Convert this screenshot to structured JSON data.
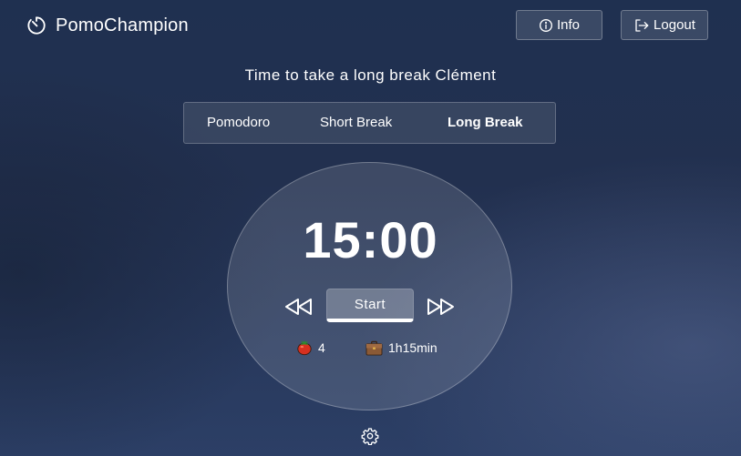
{
  "app": {
    "name": "PomoChampion",
    "logo_icon": "timer-icon"
  },
  "header": {
    "info_label": "Info",
    "info_icon": "info-icon",
    "logout_label": "Logout",
    "logout_icon": "logout-icon"
  },
  "greeting": "Time to take a long break Clément",
  "tabs": [
    {
      "label": "Pomodoro",
      "active": false
    },
    {
      "label": "Short Break",
      "active": false
    },
    {
      "label": "Long Break",
      "active": true
    }
  ],
  "timer": {
    "time": "15:00",
    "start_label": "Start",
    "prev_icon": "skip-back-icon",
    "next_icon": "skip-forward-icon"
  },
  "stats": {
    "pomodoros": "4",
    "pomodoro_icon": "tomato-icon",
    "work_time": "1h15min",
    "work_icon": "briefcase-icon"
  },
  "settings_icon": "gear-icon",
  "colors": {
    "background_top": "#1f3050",
    "background_bottom": "#2c3f66",
    "text": "#ffffff"
  }
}
